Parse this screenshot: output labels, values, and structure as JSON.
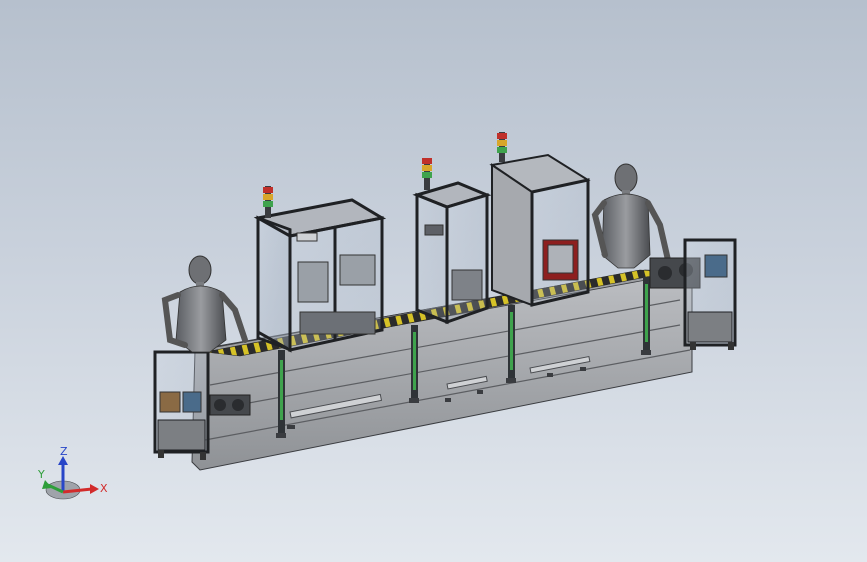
{
  "triad": {
    "x_label": "X",
    "y_label": "Y",
    "z_label": "Z"
  },
  "colors": {
    "background_top": "#b6c0cd",
    "background_bottom": "#e3e8ee",
    "frame": "#2a2d31",
    "panel": "#a7a9ad",
    "accent_green": "#3fa34d",
    "axis_x": "#d22b2b",
    "axis_y": "#2e9e3a",
    "axis_z": "#2846c8"
  }
}
